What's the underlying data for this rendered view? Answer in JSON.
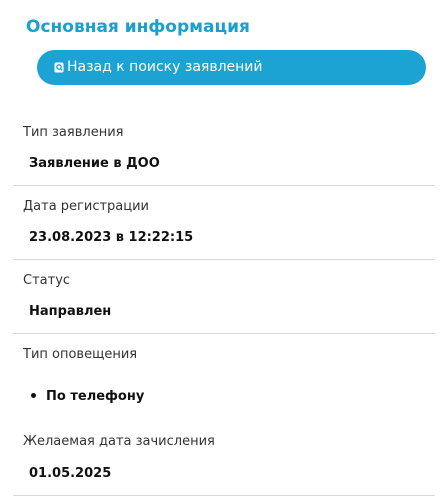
{
  "section": {
    "title": "Основная информация",
    "back_button_label": "Назад к поиску заявлений",
    "back_button_icon": "search-document-icon",
    "accent_color": "#1ca3d4"
  },
  "fields": {
    "type": {
      "label": "Тип заявления",
      "value": "Заявление в ДОО"
    },
    "registration_date": {
      "label": "Дата регистрации",
      "value": "23.08.2023 в 12:22:15"
    },
    "status": {
      "label": "Статус",
      "value": "Направлен"
    },
    "notification": {
      "label": "Тип оповещения",
      "items": [
        "По телефону"
      ]
    },
    "enrollment_date": {
      "label": "Желаемая дата зачисления",
      "value": "01.05.2025"
    }
  }
}
